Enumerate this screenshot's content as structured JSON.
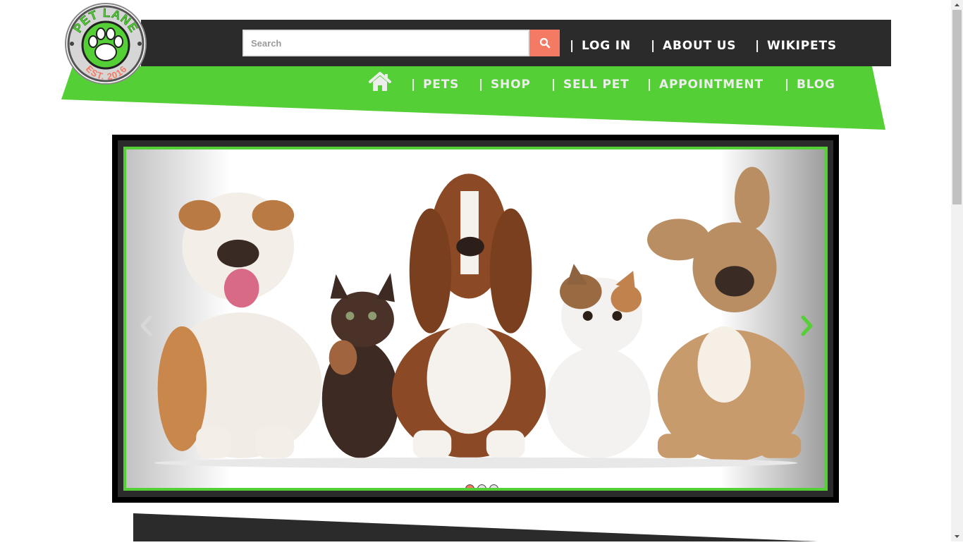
{
  "logo": {
    "top_text": "PET LANE",
    "bottom_text": "EST. 2016",
    "paw_icon": "paw-icon"
  },
  "search": {
    "placeholder": "Search",
    "value": "",
    "icon": "search-icon"
  },
  "top_nav": [
    {
      "separator": "|",
      "label": "LOG IN"
    },
    {
      "separator": "|",
      "label": "ABOUT US"
    },
    {
      "separator": "|",
      "label": "WIKIPETS"
    }
  ],
  "main_nav": {
    "home_icon": "home-icon",
    "items": [
      {
        "separator": "|",
        "label": "PETS"
      },
      {
        "separator": "|",
        "label": "SHOP"
      },
      {
        "separator": "|",
        "label": "SELL PET"
      },
      {
        "separator": "|",
        "label": "APPOINTMENT"
      },
      {
        "separator": "|",
        "label": "BLOG"
      }
    ]
  },
  "carousel": {
    "slide": "bulldog, tortoiseshell kitten, basset hound, exotic shorthair cat and french bulldog sitting in a row",
    "prev_icon": "chevron-left-icon",
    "next_icon": "chevron-right-icon",
    "indicators": 3,
    "active_index": 0
  },
  "colors": {
    "brand_green": "#55cf36",
    "dark_bar": "#2b2b2b",
    "accent_salmon": "#f47a64",
    "nav_text": "#ededed"
  }
}
